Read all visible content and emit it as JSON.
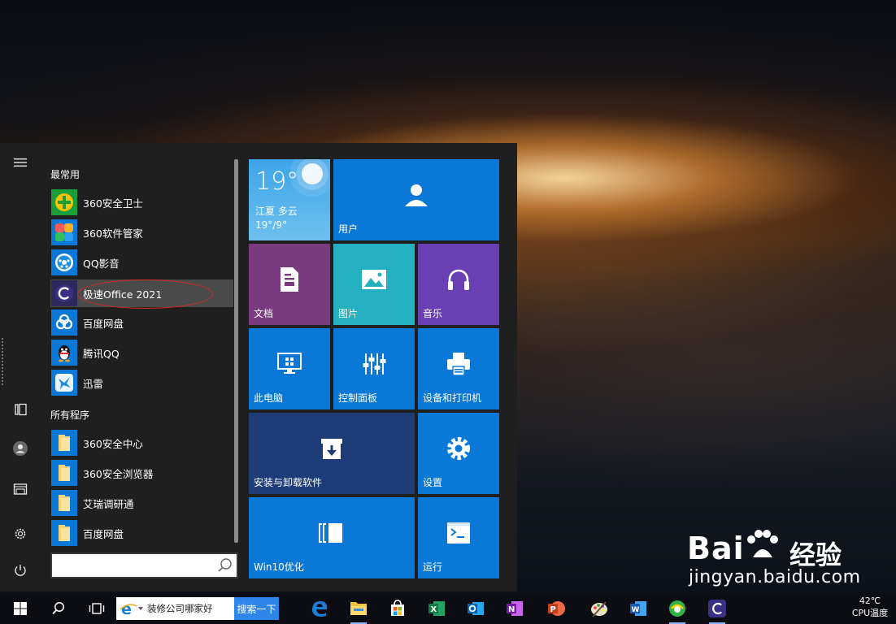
{
  "start_menu": {
    "frequent_title": "最常用",
    "all_programs_title": "所有程序",
    "frequent_apps": [
      {
        "label": "360安全卫士",
        "icon": "360-security-icon"
      },
      {
        "label": "360软件管家",
        "icon": "360-software-manager-icon"
      },
      {
        "label": "QQ影音",
        "icon": "qq-player-icon"
      },
      {
        "label": "极速Office 2021",
        "icon": "jisu-office-icon"
      },
      {
        "label": "百度网盘",
        "icon": "baidu-netdisk-icon"
      },
      {
        "label": "腾讯QQ",
        "icon": "tencent-qq-icon"
      },
      {
        "label": "迅雷",
        "icon": "xunlei-icon"
      }
    ],
    "all_programs": [
      {
        "label": "360安全中心",
        "icon": "folder-icon"
      },
      {
        "label": "360安全浏览器",
        "icon": "folder-icon"
      },
      {
        "label": "艾瑞调研通",
        "icon": "folder-icon"
      },
      {
        "label": "百度网盘",
        "icon": "folder-icon"
      }
    ],
    "search_placeholder": ""
  },
  "tiles": {
    "weather": {
      "temp": "19°",
      "location": "江夏 多云",
      "range": "19°/9°"
    },
    "user": "用户",
    "documents": "文档",
    "pictures": "图片",
    "music": "音乐",
    "this_pc": "此电脑",
    "control_panel": "控制面板",
    "devices_printers": "设备和打印机",
    "install_uninstall": "安装与卸载软件",
    "settings": "设置",
    "win10_optimize": "Win10优化",
    "run": "运行"
  },
  "taskbar": {
    "search_text": "装修公司哪家好",
    "search_button": "搜索一下",
    "temperature": "42℃",
    "temperature_label": "CPU温度"
  },
  "watermark": {
    "logo": "Bai",
    "brand": "经验",
    "url": "jingyan.baidu.com"
  },
  "colors": {
    "tile_blue": "#0a78d7",
    "tile_purple": "#7a3a80",
    "tile_teal": "#23b0c0",
    "tile_violet": "#6a3fb4",
    "tile_navy": "#1e3c78",
    "selection_oval": "#d9262a"
  }
}
